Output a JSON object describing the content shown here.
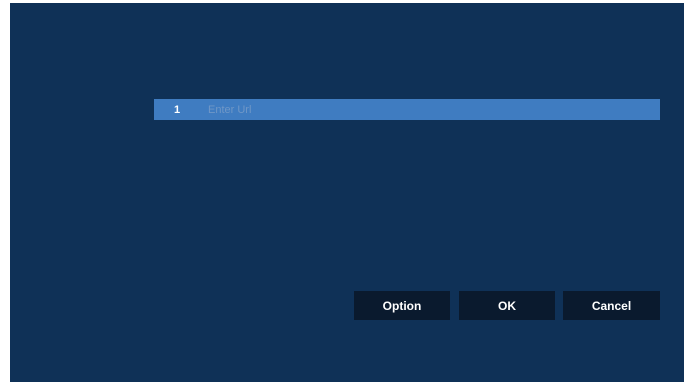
{
  "url_list": {
    "rows": [
      {
        "index": "1",
        "placeholder": "Enter Url",
        "value": ""
      }
    ]
  },
  "buttons": {
    "option_label": "Option",
    "ok_label": "OK",
    "cancel_label": "Cancel"
  },
  "colors": {
    "panel_background": "#0f3157",
    "selected_row": "#3f7cc1",
    "button_background": "#0a1a2e",
    "placeholder_text": "#6f97c7"
  }
}
